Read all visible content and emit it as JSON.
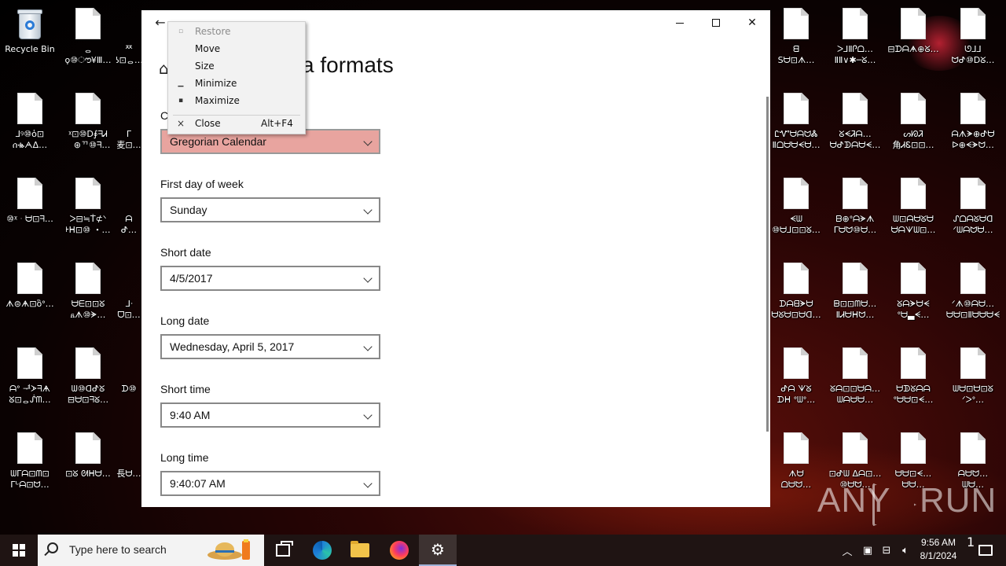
{
  "desktop": {
    "icons": [
      {
        "label1": "Recycle Bin",
        "label2": ""
      },
      {
        "label1": "ᆼ",
        "label2": "ϙ⑩ൗ¥Ⅲ…"
      },
      {
        "label1": "ᄍ",
        "label2": "ʖ⊡ᆼ…"
      },
      {
        "label1": "⅃ꝰ⑩ὁ⊡",
        "label2": "ሰቈᗅᐃ…"
      },
      {
        "label1": "ᵡ⊡⑩ᗞ∮ᖷᏗ",
        "label2": "ᅟ⊛ᄁ⑩ᖷ…"
      },
      {
        "label1": "ᒥ",
        "label2": "麦⊡…"
      },
      {
        "label1": "⑩ᵡᆞᗨ⊡ᖷ…",
        "label2": ""
      },
      {
        "label1": "ᐳ⊟≒Ṫ⊄ᐠ",
        "label2": "ᡰᕼ⊡⑩ ・…"
      },
      {
        "label1": "ᗩ",
        "label2": "ᕷ…"
      },
      {
        "label1": "ᗑ⊜ᗗ⊡ὃᐤ…",
        "label2": ""
      },
      {
        "label1": "ᗨᗴ⊡⊡ᘜ",
        "label2": "ᏺᗑ⑩ᗘ…"
      },
      {
        "label1": "ᒧᐧ",
        "label2": "ᗜ⊡…"
      },
      {
        "label1": "ᗩᐤ ᅾᗆᖷᗗ",
        "label2": "ᘜ⊡ᆼᔒᗰ…"
      },
      {
        "label1": "ᗯ⑩ᗡᕷᘜ",
        "label2": "⊟ᗨ⊡ᖷᘜ…"
      },
      {
        "label1": "ᗪ⑩",
        "label2": "ᗢᖷ…"
      },
      {
        "label1": "ᗯᒥᗩ⊡ᗰ⊡",
        "label2": "ᒥᒡᗩ⊡ᗢ…"
      },
      {
        "label1": "⊡ᘜ ᘛᕼᗨ…",
        "label2": ""
      },
      {
        "label1": "ᗴ",
        "label2": "長ᗨ…"
      },
      {
        "label1": "ᗺ",
        "label2": "Sᗨ⊡ᗑ…"
      },
      {
        "label1": "ᐳ⅃ⅡᎵᗝ…",
        "label2": "ⅡⅡ∨✱─ᘜ…"
      },
      {
        "label1": "⊟ᗪᗩᗗ⊕ᘜ…",
        "label2": ""
      },
      {
        "label1": "ᘎ⅃⅃",
        "label2": "ᗢᕷ⑩ᗞᘜ…"
      },
      {
        "label1": "ᏝᏉᗨᗩᗢᏜ",
        "label2": "Ⅱᗝᗨᗨᗕᗨ…"
      },
      {
        "label1": "ᘜᗕᏘᗩ…",
        "label2": "ᗨᕷᗫᗩᗨᗕ…"
      },
      {
        "label1": "ᔕᘗᏘ",
        "label2": "角ᏗᏋ⊡⊡…"
      },
      {
        "label1": "ᗩᗑᗚ⊕ᕷᗨ",
        "label2": "ᐅ⊕ᗕᗘᗢ…"
      },
      {
        "label1": "ᗕᗯ",
        "label2": "⑩ᗨ⅃⊡⊡ᘜ…"
      },
      {
        "label1": "ᗷ⊕ᐤᗩᗘᗑ",
        "label2": "ᒥᗨᗢ⑩ᗨ…"
      },
      {
        "label1": "ᗯ⊡ᗩᗨᘜᗨ",
        "label2": "ᗨᗩᗐᗯ⊡…"
      },
      {
        "label1": "ᔑᗝᗩᘜᗨᗡ",
        "label2": "ᐟᗯᗩᗢᗨ…"
      },
      {
        "label1": "ᗪᗩᗺᗚᗨ",
        "label2": "ᗨᘜᗨ⊡ᗨᗡ…"
      },
      {
        "label1": "ᗸ⊡⊡ᗰᗨ…",
        "label2": "ⅡᏗᗨᕼᗢ…"
      },
      {
        "label1": "ᘜᗩᗚᗨᗕ",
        "label2": "ᐤᗨ▃ᗕ…"
      },
      {
        "label1": "ᐟᗑ⑩ᗩᗨ…",
        "label2": "ᗨᗨ⊡Ⅱᗨᗨᗨᗕ"
      },
      {
        "label1": "ᕷᗩ ᗐᘜ",
        "label2": "ᗪᕼ ᐤᗯᐤ…"
      },
      {
        "label1": "ᘜᗩ⊡⊡ᗨᗩ…",
        "label2": "ᗯᗩᗨᗨ…"
      },
      {
        "label1": "ᗨᗫᘜᗩᗩ",
        "label2": "ᐤᗨᗨ⊡ᗕ…"
      },
      {
        "label1": "ᗯᗨ⊡ᗨ⊡ᘜ",
        "label2": "ᐟᐳᐤ…"
      },
      {
        "label1": "ᗑᗨ",
        "label2": "ᗝᗨᗢ…"
      },
      {
        "label1": "⊡ᕷᗯ ᐃᗩ⊡…",
        "label2": "⑩ᗨᗢ…"
      },
      {
        "label1": "ᗨᗨ⊡ᗕ…",
        "label2": "ᗨᗨ…"
      },
      {
        "label1": "ᗩᗨᗢ…",
        "label2": "ᗯᗨ…"
      }
    ]
  },
  "window": {
    "back_icon": "←",
    "page_title": "a formats",
    "scroll_label_hidden": "C",
    "fields": [
      {
        "label": "",
        "value": "Gregorian Calendar"
      },
      {
        "label": "First day of week",
        "value": "Sunday"
      },
      {
        "label": "Short date",
        "value": "4/5/2017"
      },
      {
        "label": "Long date",
        "value": "Wednesday, April 5, 2017"
      },
      {
        "label": "Short time",
        "value": "9:40 AM"
      },
      {
        "label": "Long time",
        "value": "9:40:07 AM"
      }
    ]
  },
  "context_menu": {
    "items": [
      {
        "label": "Restore",
        "icon": "▫",
        "shortcut": "",
        "enabled": false
      },
      {
        "label": "Move",
        "icon": "",
        "shortcut": "",
        "enabled": true
      },
      {
        "label": "Size",
        "icon": "",
        "shortcut": "",
        "enabled": true
      },
      {
        "label": "Minimize",
        "icon": "▁",
        "shortcut": "",
        "enabled": true
      },
      {
        "label": "Maximize",
        "icon": "▪",
        "shortcut": "",
        "enabled": true
      },
      {
        "label": "Close",
        "icon": "×",
        "shortcut": "Alt+F4",
        "enabled": true
      }
    ]
  },
  "taskbar": {
    "search_placeholder": "Type here to search",
    "time": "9:56 AM",
    "date": "8/1/2024",
    "notification_count": "1"
  },
  "watermark": {
    "left": "ANY",
    "right": "RUN"
  }
}
